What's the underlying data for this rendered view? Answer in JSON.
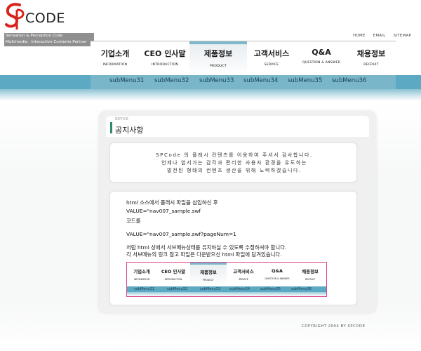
{
  "brand": {
    "logo_letters": "SP",
    "logo_word": "CODE",
    "tagline_1": "Sensation & Perception Code",
    "tagline_2": "Multimedia . Interactive Contents Partner",
    "accent_red": "#d8231f",
    "accent_blue": "#5ba9c2"
  },
  "util_links": [
    "HOME",
    "EMAIL",
    "SITEMAP"
  ],
  "gnb": [
    {
      "ko": "기업소개",
      "en": "INFORMATION",
      "active": false
    },
    {
      "ko": "CEO 인사말",
      "en": "INTRODUCTION",
      "active": false
    },
    {
      "ko": "제품정보",
      "en": "PRODUCT",
      "active": true
    },
    {
      "ko": "고객서비스",
      "en": "SERVICE",
      "active": false
    },
    {
      "ko": "Q&A",
      "en": "QUESTION & ANSWER",
      "active": false
    },
    {
      "ko": "채용정보",
      "en": "RECRUIT",
      "active": false
    }
  ],
  "submenu": [
    "subMenu31",
    "subMenu32",
    "subMenu33",
    "subMenu34",
    "subMenu35",
    "subMenu36"
  ],
  "notice": {
    "label": "NOTICE",
    "title": "공지사항"
  },
  "intro_lines": [
    "SPCode 의 플래시 컨텐츠를 이용하여 주셔서 감사합니다.",
    "언제나 앞서가는 감각과 편리한 사용자 환경을 유도하는",
    "발전된 형태의 컨텐츠 생산을 위해 노력하겠습니다."
  ],
  "code_lines": [
    "html 소스에서 플래시 파일을 삽입하신 후",
    "VALUE=\"nav007_sample.swf",
    "코드를",
    "VALUE=\"nav007_sample.swf?pageNum=1",
    "처럼 html 상에서 서브메뉴상태를 유지하실 수  있도록 수정하셔야 합니다.",
    "각 서브메뉴의 링크 참고 파일은 다운받으신 html 파일에 담겨있습니다."
  ],
  "preview": {
    "gnb": [
      {
        "ko": "기업소개",
        "en": "INFORMATION"
      },
      {
        "ko": "CEO 인사말",
        "en": "INTRODUCTION"
      },
      {
        "ko": "제품정보",
        "en": "PRODUCT"
      },
      {
        "ko": "고객서비스",
        "en": "SERVICE"
      },
      {
        "ko": "Q&A",
        "en": "QUESTION & ANSWER"
      },
      {
        "ko": "채용정보",
        "en": "RECRUIT"
      }
    ],
    "submenu": [
      "subMenu31",
      "subMenu32",
      "subMenu33",
      "subMenu34",
      "subMenu35",
      "subMenu36"
    ],
    "border_color": "#e0408a"
  },
  "copyright": "COPYRIGHT 2004 BY SPCODE"
}
